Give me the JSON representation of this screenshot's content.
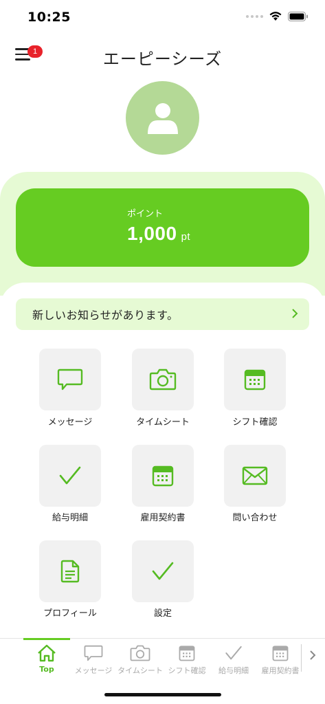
{
  "status_bar": {
    "time": "10:25"
  },
  "header": {
    "title": "エーピーシーズ",
    "menu_badge": "1"
  },
  "points": {
    "label": "ポイント",
    "value": "1,000",
    "unit": "pt"
  },
  "notice": {
    "text": "新しいお知らせがあります。"
  },
  "menu": [
    {
      "label": "メッセージ",
      "icon": "message-icon"
    },
    {
      "label": "タイムシート",
      "icon": "camera-icon"
    },
    {
      "label": "シフト確認",
      "icon": "calendar-icon"
    },
    {
      "label": "給与明細",
      "icon": "check-icon"
    },
    {
      "label": "雇用契約書",
      "icon": "calendar-icon"
    },
    {
      "label": "問い合わせ",
      "icon": "mail-icon"
    },
    {
      "label": "プロフィール",
      "icon": "document-icon"
    },
    {
      "label": "設定",
      "icon": "check-icon"
    }
  ],
  "tabs": [
    {
      "label": "Top",
      "icon": "home-icon"
    },
    {
      "label": "メッセージ",
      "icon": "message-icon"
    },
    {
      "label": "タイムシート",
      "icon": "camera-icon"
    },
    {
      "label": "シフト確認",
      "icon": "calendar-icon"
    },
    {
      "label": "給与明細",
      "icon": "check-icon"
    },
    {
      "label": "雇用契約書",
      "icon": "calendar-icon"
    }
  ],
  "colors": {
    "accent": "#66cc22",
    "accent_light": "#e6fad4",
    "avatar": "#b4d996",
    "badge": "#e8222a"
  }
}
